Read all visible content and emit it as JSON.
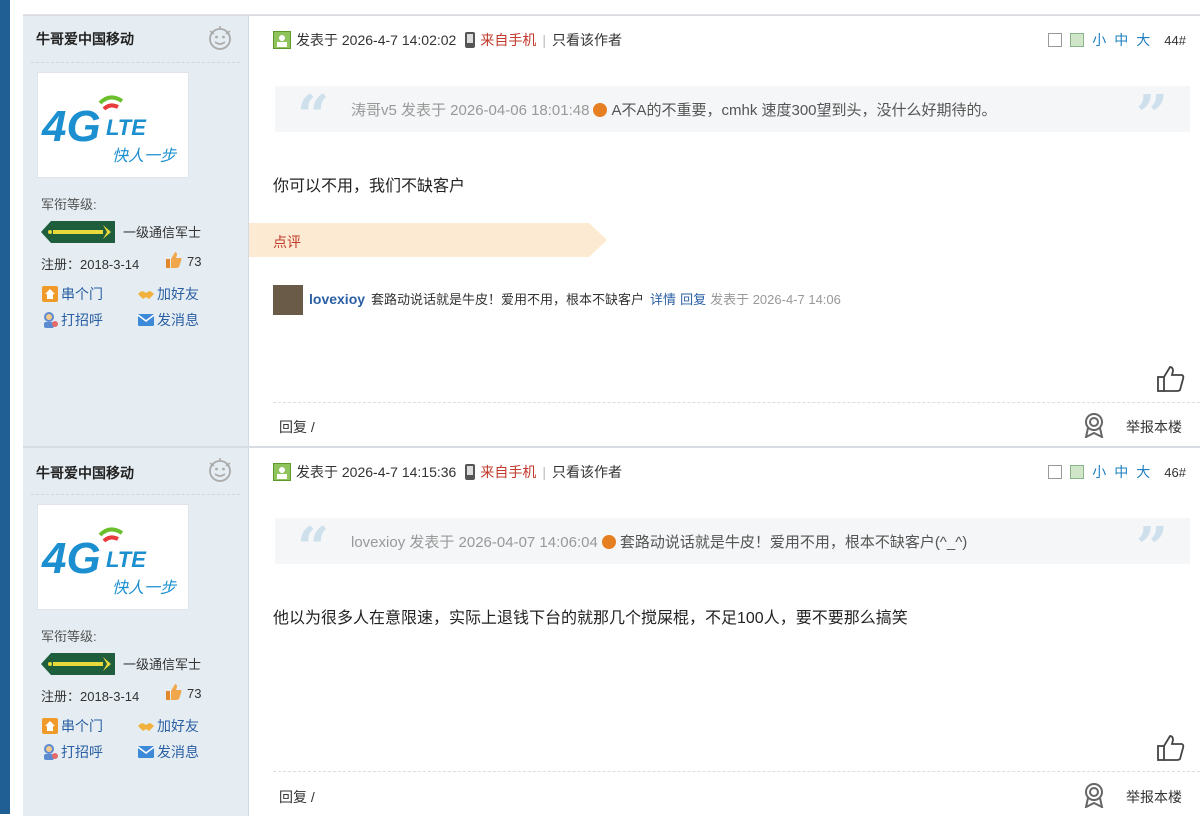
{
  "posts": [
    {
      "user": {
        "name": "牛哥爱中国移动",
        "rank_label": "军衔等级:",
        "rank_name": "一级通信军士",
        "reg": "注册：2018-3-14",
        "score": "73",
        "actions": [
          "串个门",
          "加好友",
          "打招呼",
          "发消息"
        ],
        "avatar_big": "4G",
        "avatar_lte": "LTE",
        "avatar_slogan": "快人一步"
      },
      "header": {
        "posted": "发表于 2026-4-7 14:02:02",
        "mobile": "来自手机",
        "author_only": "只看该作者",
        "font_small": "小",
        "font_mid": "中",
        "font_big": "大",
        "floor": "44#"
      },
      "quote": {
        "meta": "涛哥v5 发表于 2026-04-06 18:01:48",
        "text": "A不A的不重要，cmhk 速度300望到头，没什么好期待的。"
      },
      "body": "你可以不用，我们不缺客户",
      "review_label": "点评",
      "comment": {
        "name": "lovexioy",
        "text": "套路动说话就是牛皮！爱用不用，根本不缺客户",
        "detail": "详情",
        "reply": "回复",
        "time": "发表于 2026-4-7 14:06"
      },
      "footer": {
        "reply": "回复  /",
        "report": "举报本楼"
      }
    },
    {
      "user": {
        "name": "牛哥爱中国移动",
        "rank_label": "军衔等级:",
        "rank_name": "一级通信军士",
        "reg": "注册：2018-3-14",
        "score": "73",
        "actions": [
          "串个门",
          "加好友",
          "打招呼",
          "发消息"
        ],
        "avatar_big": "4G",
        "avatar_lte": "LTE",
        "avatar_slogan": "快人一步"
      },
      "header": {
        "posted": "发表于 2026-4-7 14:15:36",
        "mobile": "来自手机",
        "author_only": "只看该作者",
        "font_small": "小",
        "font_mid": "中",
        "font_big": "大",
        "floor": "46#"
      },
      "quote": {
        "meta": "lovexioy 发表于 2026-04-07 14:06:04",
        "text": "套路动说话就是牛皮！爱用不用，根本不缺客户(^_^)"
      },
      "body": "他以为很多人在意限速，实际上退钱下台的就那几个搅屎棍，不足100人，要不要那么搞笑",
      "footer": {
        "reply": "回复  /",
        "report": "举报本楼"
      }
    }
  ],
  "colors": {
    "accent": "#1d7fbf",
    "mobile": "#c0392b",
    "sidebar": "#e5edf2",
    "link": "#2b5fa3"
  }
}
